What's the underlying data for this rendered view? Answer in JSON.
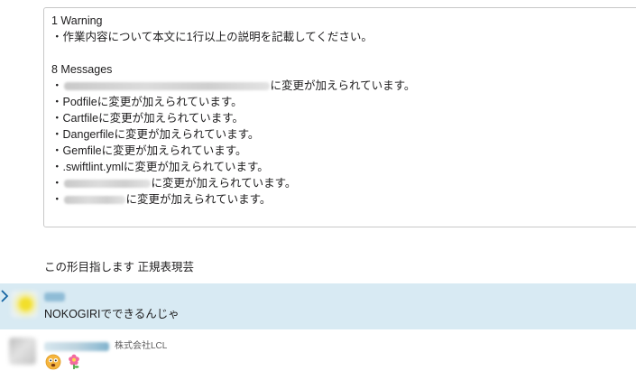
{
  "attachment": {
    "warning_header": "1 Warning",
    "warning_item": "・作業内容について本文に1行以上の説明を記載してください。",
    "messages_header": "8 Messages",
    "bullet": "・",
    "changed_suffix": "に変更が加えられています。",
    "files": [
      "Podfile",
      "Cartfile",
      "Dangerfile",
      "Gemfile",
      ".swiftlint.yml"
    ]
  },
  "plain_message": "この形目指します 正規表現芸",
  "messages": [
    {
      "text": "NOKOGIRIでできるんじゃ"
    },
    {
      "org": "株式会社LCL",
      "reactions": [
        "worried-face-emoji",
        "flower-emoji"
      ]
    }
  ],
  "colors": {
    "highlight": "#d8eaf3",
    "accent": "#1264a3"
  }
}
